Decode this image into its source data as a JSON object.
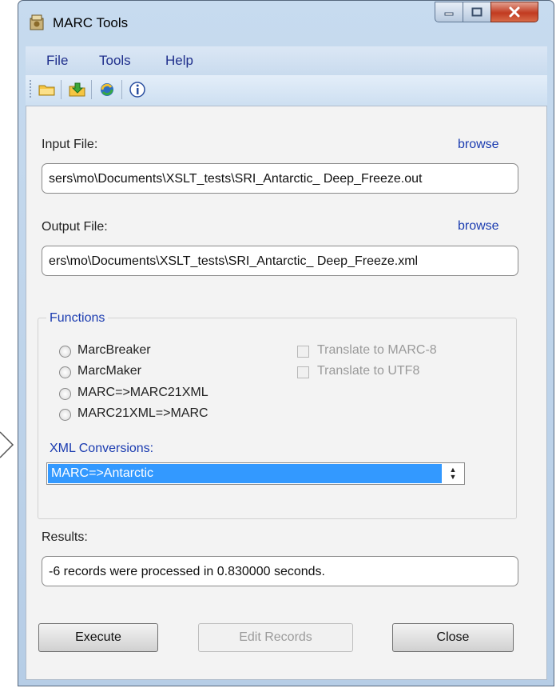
{
  "window": {
    "title": "MARC Tools"
  },
  "menu": {
    "file": "File",
    "tools": "Tools",
    "help": "Help"
  },
  "toolbar": {
    "icons": [
      "open-folder-icon",
      "save-folder-icon",
      "refresh-icon",
      "info-icon"
    ]
  },
  "input": {
    "label": "Input File:",
    "browse": "browse",
    "value": "sers\\mo\\Documents\\XSLT_tests\\SRI_Antarctic_ Deep_Freeze.out"
  },
  "output": {
    "label": "Output File:",
    "browse": "browse",
    "value": "ers\\mo\\Documents\\XSLT_tests\\SRI_Antarctic_ Deep_Freeze.xml"
  },
  "functions": {
    "label": "Functions",
    "radios": [
      "MarcBreaker",
      "MarcMaker",
      "MARC=>MARC21XML",
      "MARC21XML=>MARC"
    ],
    "checks": [
      "Translate to MARC-8",
      "Translate to UTF8"
    ]
  },
  "xml": {
    "label": "XML Conversions:",
    "selected": "MARC=>Antarctic"
  },
  "results": {
    "label": "Results:",
    "value": "-6 records were processed in 0.830000 seconds."
  },
  "buttons": {
    "execute": "Execute",
    "edit": "Edit Records",
    "close": "Close"
  }
}
